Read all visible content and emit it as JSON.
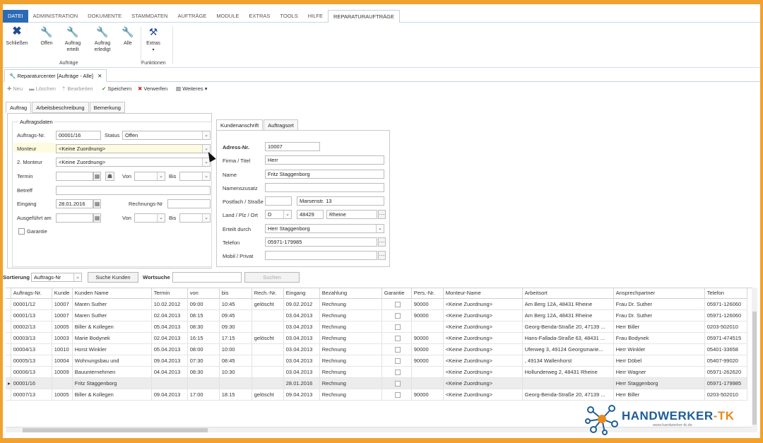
{
  "window_title": "Reparaturcenter",
  "menu": [
    "DATEI",
    "ADMINISTRATION",
    "DOKUMENTE",
    "STAMMDATEN",
    "AUFTRÄGE",
    "MODULE",
    "EXTRAS",
    "TOOLS",
    "HILFE",
    "REPARATURAUFTRÄGE"
  ],
  "ribbon": {
    "buttons": [
      {
        "label": "Schließen",
        "icon": "close-x-icon"
      },
      {
        "label": "Offen",
        "icon": "wrench-icon"
      },
      {
        "label": "Auftrag\nerteilt",
        "icon": "wrench-icon"
      },
      {
        "label": "Auftrag\nerledigt",
        "icon": "wrench-icon"
      },
      {
        "label": "Alle",
        "icon": "wrench-icon"
      },
      {
        "label": "Extras",
        "icon": "tools-icon"
      }
    ],
    "group_auftraege": "Aufträge",
    "group_funktionen": "Funktionen"
  },
  "doc_tab": {
    "title": "Reparaturcenter [Aufträge - Alle]",
    "close": "✕"
  },
  "toolbar": {
    "neu": "Neu",
    "loeschen": "Löschen",
    "bearbeiten": "Bearbeiten",
    "speichern": "Speichern",
    "verwerfen": "Verwerfen",
    "weiteres": "Weiteres ▾"
  },
  "subtabs": [
    "Auftrag",
    "Arbeitsbeschreibung",
    "Bemerkung"
  ],
  "auftragsdaten": {
    "legend": "Auftragsdaten",
    "auftrags_nr_label": "Auftrags-Nr.",
    "auftrags_nr": "00001/16",
    "status_label": "Status",
    "status": "Offen",
    "monteur_label": "Monteur",
    "monteur": "<Keine Zuordnung>",
    "monteur2_label": "2. Monteur",
    "monteur2": "<Keine Zuordnung>",
    "termin_label": "Termin",
    "von_label": "Von",
    "bis_label": "Bis",
    "betreff_label": "Betreff",
    "eingang_label": "Eingang",
    "eingang": "28.01.2016",
    "rechnungs_nr_label": "Rechnungs-Nr",
    "ausgefuehrt_label": "Ausgeführt am",
    "garantie_label": "Garantie"
  },
  "right_tabs": [
    "Kundenanschrift",
    "Auftragsort"
  ],
  "kunde": {
    "adress_nr_label": "Adress-Nr.",
    "adress_nr": "10007",
    "firma_label": "Firma / Titel",
    "firma": "Herr",
    "name_label": "Name",
    "name": "Fritz Staggenborg",
    "namenszusatz_label": "Namenszusatz",
    "postfach_label": "Postfach / Straße",
    "strasse": "Marsenstr. 13",
    "land_label": "Land / Plz / Ort",
    "land": "D",
    "plz": "48429",
    "ort": "Rheine",
    "erteilt_label": "Erteilt durch",
    "erteilt": "Herr Staggenborg",
    "telefon_label": "Telefon",
    "telefon": "05971-179985",
    "mobil_label": "Mobil / Privat"
  },
  "search": {
    "sortierung_label": "Sortierung",
    "sortierung": "Auftrags-Nr",
    "suche_kunden": "Suche Kunden",
    "wortsuche_label": "Wortsuche",
    "suchen": "Suchen"
  },
  "table": {
    "columns": [
      "Auftrags-Nr.",
      "Kunde",
      "Kunden Name",
      "Termin",
      "von",
      "bis",
      "Rech.-Nr.",
      "Eingang",
      "Bezahlung",
      "Garantie",
      "Pers.-Nr.",
      "Monteur-Name",
      "Arbeitsort",
      "Ansprechpartner",
      "Telefon"
    ],
    "rows": [
      [
        "00001/12",
        "10007",
        "Maren Suther",
        "10.02.2012",
        "09:00",
        "10:45",
        "gelöscht",
        "09.02.2012",
        "Rechnung",
        "",
        "90000",
        "<Keine Zuordnung>",
        "Am Berg 12A, 48431 Rheine",
        "Frau Dr. Suther",
        "05971-126060"
      ],
      [
        "00001/13",
        "10007",
        "Maren Suther",
        "02.04.2013",
        "08:15",
        "09:45",
        "",
        "03.04.2013",
        "Rechnung",
        "",
        "90000",
        "<Keine Zuordnung>",
        "Am Berg 12A, 48431 Rheine",
        "Frau Dr. Suther",
        "05971-126060"
      ],
      [
        "00002/13",
        "10005",
        "Biller & Kollegen",
        "05.04.2013",
        "08:30",
        "09:30",
        "",
        "03.04.2013",
        "Rechnung",
        "",
        "",
        "<Keine Zuordnung>",
        "Georg-Benda-Straße 20, 47139 ...",
        "Herr Biller",
        "0203-502010"
      ],
      [
        "00003/13",
        "10003",
        "Marie Bodynek",
        "02.04.2013",
        "16:15",
        "17:15",
        "gelöscht",
        "03.04.2013",
        "Rechnung",
        "",
        "90000",
        "<Keine Zuordnung>",
        "Hans-Fallada-Straße 63, 48431 ...",
        "Frau Bodynek",
        "05971-474515"
      ],
      [
        "00004/13",
        "10010",
        "Horst Winkler",
        "05.04.2013",
        "08:00",
        "10:00",
        "",
        "03.04.2013",
        "Rechnung",
        "",
        "90000",
        "<Keine Zuordnung>",
        "Uferweg 3, 49124 Georgsmarie...",
        "Herr Winkler",
        "05401-33658"
      ],
      [
        "00005/13",
        "10004",
        "Wohnungsbau und",
        "09.04.2013",
        "07:30",
        "08:45",
        "",
        "03.04.2013",
        "Rechnung",
        "",
        "90000",
        "<Keine Zuordnung>",
        ", 49134 Wallenhorst",
        "Herr Döbel",
        "05407-99020"
      ],
      [
        "00006/13",
        "10009",
        "Bauunternehmen",
        "04.04.2013",
        "08:30",
        "10:30",
        "",
        "03.04.2013",
        "Rechnung",
        "",
        "",
        "<Keine Zuordnung>",
        "Hollunderweg 2, 48431 Rheine",
        "Herr Wagner",
        "05971-262620"
      ],
      [
        "00001/16",
        "",
        "Fritz Staggenborg",
        "",
        "",
        "",
        "",
        "28.01.2016",
        "Rechnung",
        "",
        "",
        "<Keine Zuordnung>",
        "",
        "Herr Staggenborg",
        "05971-179985"
      ],
      [
        "00007/13",
        "10005",
        "Biller & Kollegen",
        "09.04.2013",
        "17:00",
        "18:15",
        "gelöscht",
        "09.04.2013",
        "Rechnung",
        "",
        "90000",
        "<Keine Zuordnung>",
        "Georg-Benda-Straße 20, 47139 ...",
        "Herr Biller",
        "0203-502010"
      ]
    ]
  },
  "logo": {
    "name": "HANDWERKER-TK",
    "url": "www.handwerker-tk.de"
  },
  "colors": {
    "frame": "#f1a22e",
    "file_menu": "#2b6bb5",
    "logo_blue": "#1f5d97",
    "logo_orange": "#e98a1d"
  }
}
